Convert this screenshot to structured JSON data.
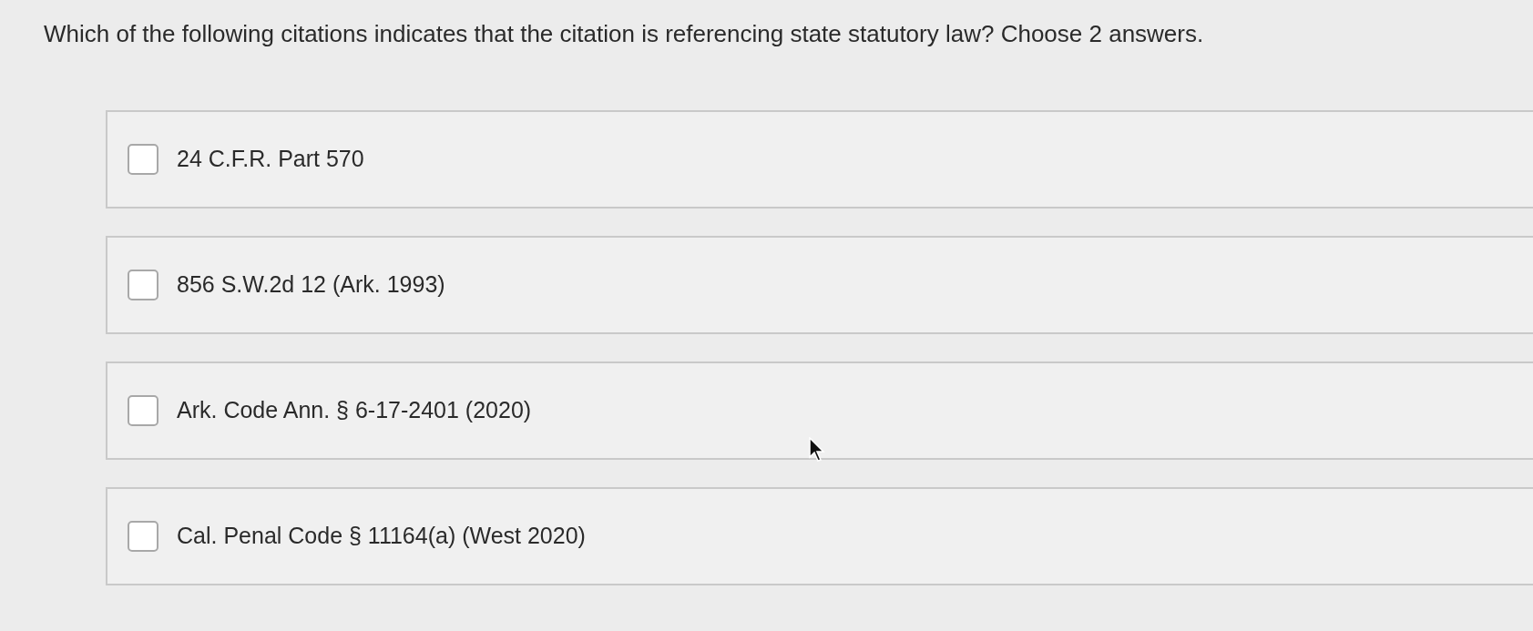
{
  "question": "Which of the following citations indicates that the citation is referencing state statutory law? Choose 2 answers.",
  "options": [
    {
      "label": "24 C.F.R. Part 570",
      "checked": false
    },
    {
      "label": "856 S.W.2d 12 (Ark. 1993)",
      "checked": false
    },
    {
      "label": "Ark. Code Ann. § 6-17-2401 (2020)",
      "checked": false
    },
    {
      "label": "Cal. Penal Code § 11164(a) (West 2020)",
      "checked": false
    }
  ]
}
